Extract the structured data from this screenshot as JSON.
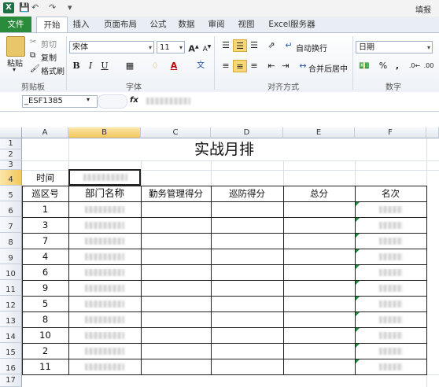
{
  "title_bar": {
    "app_icon": "excel-icon",
    "title_fragment": "填报"
  },
  "tabs": [
    "文件",
    "开始",
    "插入",
    "页面布局",
    "公式",
    "数据",
    "审阅",
    "视图",
    "Excel服务器"
  ],
  "active_tab": "开始",
  "clipboard": {
    "paste": "粘贴",
    "cut": "剪切",
    "copy": "复制",
    "format_painter": "格式刷",
    "group": "剪贴板"
  },
  "font": {
    "name": "宋体",
    "size": "11",
    "group": "字体",
    "bold": "B",
    "italic": "I",
    "underline": "U"
  },
  "alignment": {
    "wrap": "自动换行",
    "merge": "合并后居中",
    "group": "对齐方式"
  },
  "number": {
    "format": "日期",
    "percent": "%",
    "comma": ",",
    "group": "数字"
  },
  "formula_bar": {
    "name_box": "_ESF1385",
    "fx": "fx"
  },
  "columns": [
    "A",
    "B",
    "C",
    "D",
    "E",
    "F"
  ],
  "selected_column": "B",
  "rows": [
    "1",
    "2",
    "3",
    "4",
    "5",
    "6",
    "7",
    "8",
    "9",
    "10",
    "11",
    "12",
    "13",
    "14",
    "15",
    "16",
    "17"
  ],
  "selected_row": "4",
  "sheet": {
    "title": "实战月排",
    "time_label": "时间",
    "headers": [
      "巡区号",
      "部门名称",
      "勤务管理得分",
      "巡防得分",
      "总分",
      "名次"
    ],
    "zone_numbers": [
      "1",
      "3",
      "7",
      "4",
      "6",
      "9",
      "5",
      "8",
      "10",
      "2",
      "11"
    ]
  },
  "colors": {
    "excel_green": "#1e7145",
    "file_tab": "#2a8c3a",
    "selection_header": "#f4c75b"
  }
}
